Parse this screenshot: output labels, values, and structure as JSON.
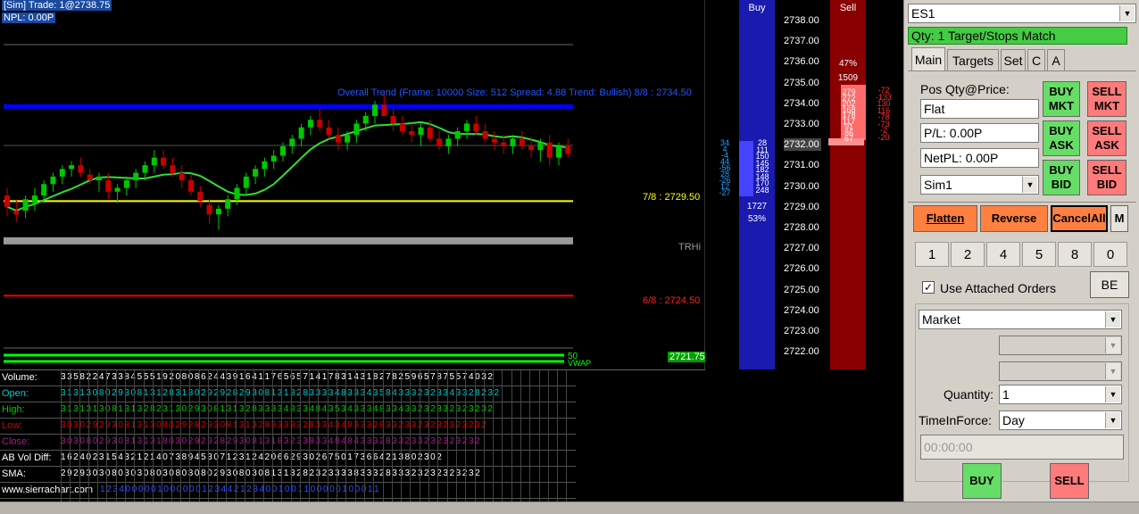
{
  "status": {
    "mode": "[Sim]",
    "trade": "Trade: 1@2738.75",
    "npl": "NPL: 0.00P"
  },
  "chart": {
    "overlay_label": "Overall Trend (Frame: 10000 Size: 512 Spread: 4.88 Trend: Bullish) 8/8 : 2734.50",
    "label_78": "7/8 : 2729.50",
    "label_trhi": "TRHi",
    "label_68": "6/8 : 2724.50",
    "label_50": "50",
    "label_vwap": "VWAP",
    "last_price": "2721.75",
    "colors": {
      "up": "#00c800",
      "down": "#c80000",
      "ma_up": "#33dd33",
      "ma_down": "#e040e0"
    }
  },
  "chart_data": {
    "type": "candlestick",
    "y_unit": "price",
    "ylim": [
      2721.5,
      2739.0
    ],
    "candles": [
      {
        "o": 2729.8,
        "h": 2730.2,
        "l": 2728.7,
        "c": 2729.2
      },
      {
        "o": 2729.0,
        "h": 2729.6,
        "l": 2728.4,
        "c": 2728.8
      },
      {
        "o": 2729.0,
        "h": 2729.8,
        "l": 2728.6,
        "c": 2729.6
      },
      {
        "o": 2729.4,
        "h": 2730.2,
        "l": 2729.0,
        "c": 2729.8
      },
      {
        "o": 2729.8,
        "h": 2730.6,
        "l": 2729.4,
        "c": 2730.4
      },
      {
        "o": 2730.4,
        "h": 2731.0,
        "l": 2730.0,
        "c": 2730.8
      },
      {
        "o": 2730.8,
        "h": 2731.4,
        "l": 2730.4,
        "c": 2731.2
      },
      {
        "o": 2731.2,
        "h": 2731.6,
        "l": 2730.8,
        "c": 2731.4
      },
      {
        "o": 2731.4,
        "h": 2731.8,
        "l": 2730.8,
        "c": 2731.0
      },
      {
        "o": 2730.9,
        "h": 2731.2,
        "l": 2730.4,
        "c": 2730.6
      },
      {
        "o": 2730.6,
        "h": 2731.0,
        "l": 2730.0,
        "c": 2730.8
      },
      {
        "o": 2730.6,
        "h": 2731.0,
        "l": 2729.6,
        "c": 2730.0
      },
      {
        "o": 2730.0,
        "h": 2730.4,
        "l": 2729.4,
        "c": 2730.2
      },
      {
        "o": 2730.2,
        "h": 2730.8,
        "l": 2729.8,
        "c": 2730.6
      },
      {
        "o": 2730.6,
        "h": 2731.2,
        "l": 2730.2,
        "c": 2731.0
      },
      {
        "o": 2731.0,
        "h": 2731.6,
        "l": 2730.6,
        "c": 2731.4
      },
      {
        "o": 2731.4,
        "h": 2732.2,
        "l": 2731.0,
        "c": 2731.8
      },
      {
        "o": 2731.8,
        "h": 2732.2,
        "l": 2731.2,
        "c": 2731.4
      },
      {
        "o": 2731.4,
        "h": 2731.8,
        "l": 2730.8,
        "c": 2731.0
      },
      {
        "o": 2731.0,
        "h": 2731.4,
        "l": 2730.2,
        "c": 2730.6
      },
      {
        "o": 2730.6,
        "h": 2730.9,
        "l": 2729.8,
        "c": 2730.0
      },
      {
        "o": 2730.0,
        "h": 2730.3,
        "l": 2729.2,
        "c": 2729.5
      },
      {
        "o": 2729.3,
        "h": 2729.6,
        "l": 2728.3,
        "c": 2728.8
      },
      {
        "o": 2728.8,
        "h": 2729.3,
        "l": 2728.0,
        "c": 2729.1
      },
      {
        "o": 2729.1,
        "h": 2729.8,
        "l": 2728.7,
        "c": 2729.6
      },
      {
        "o": 2729.6,
        "h": 2730.4,
        "l": 2729.3,
        "c": 2730.2
      },
      {
        "o": 2730.2,
        "h": 2731.0,
        "l": 2729.8,
        "c": 2730.8
      },
      {
        "o": 2730.8,
        "h": 2731.4,
        "l": 2730.4,
        "c": 2731.2
      },
      {
        "o": 2731.2,
        "h": 2731.8,
        "l": 2730.8,
        "c": 2731.6
      },
      {
        "o": 2731.6,
        "h": 2732.2,
        "l": 2731.2,
        "c": 2731.9
      },
      {
        "o": 2731.9,
        "h": 2732.6,
        "l": 2731.6,
        "c": 2732.4
      },
      {
        "o": 2732.4,
        "h": 2733.0,
        "l": 2732.0,
        "c": 2732.8
      },
      {
        "o": 2732.8,
        "h": 2733.6,
        "l": 2732.4,
        "c": 2733.4
      },
      {
        "o": 2733.4,
        "h": 2734.0,
        "l": 2733.0,
        "c": 2733.8
      },
      {
        "o": 2733.8,
        "h": 2734.4,
        "l": 2733.2,
        "c": 2733.4
      },
      {
        "o": 2733.4,
        "h": 2733.8,
        "l": 2732.8,
        "c": 2733.0
      },
      {
        "o": 2733.0,
        "h": 2733.4,
        "l": 2732.2,
        "c": 2732.6
      },
      {
        "o": 2732.6,
        "h": 2733.2,
        "l": 2732.2,
        "c": 2733.0
      },
      {
        "o": 2733.0,
        "h": 2733.8,
        "l": 2732.6,
        "c": 2733.6
      },
      {
        "o": 2733.6,
        "h": 2734.2,
        "l": 2733.2,
        "c": 2734.0
      },
      {
        "o": 2734.0,
        "h": 2734.8,
        "l": 2733.6,
        "c": 2734.6
      },
      {
        "o": 2734.6,
        "h": 2735.3,
        "l": 2734.2,
        "c": 2734.0
      },
      {
        "o": 2734.0,
        "h": 2734.4,
        "l": 2733.2,
        "c": 2733.6
      },
      {
        "o": 2733.6,
        "h": 2734.0,
        "l": 2733.0,
        "c": 2733.2
      },
      {
        "o": 2733.2,
        "h": 2733.6,
        "l": 2732.6,
        "c": 2733.0
      },
      {
        "o": 2733.0,
        "h": 2733.6,
        "l": 2732.4,
        "c": 2733.4
      },
      {
        "o": 2733.4,
        "h": 2733.8,
        "l": 2732.6,
        "c": 2732.8
      },
      {
        "o": 2732.8,
        "h": 2733.2,
        "l": 2732.2,
        "c": 2732.4
      },
      {
        "o": 2732.4,
        "h": 2733.0,
        "l": 2732.0,
        "c": 2732.8
      },
      {
        "o": 2732.8,
        "h": 2733.4,
        "l": 2732.4,
        "c": 2733.2
      },
      {
        "o": 2733.2,
        "h": 2733.8,
        "l": 2732.8,
        "c": 2733.6
      },
      {
        "o": 2733.6,
        "h": 2734.0,
        "l": 2733.0,
        "c": 2733.2
      },
      {
        "o": 2733.2,
        "h": 2733.6,
        "l": 2732.6,
        "c": 2732.8
      },
      {
        "o": 2732.8,
        "h": 2733.2,
        "l": 2732.2,
        "c": 2732.6
      },
      {
        "o": 2732.6,
        "h": 2733.0,
        "l": 2732.0,
        "c": 2732.4
      },
      {
        "o": 2732.4,
        "h": 2733.0,
        "l": 2732.0,
        "c": 2732.8
      },
      {
        "o": 2732.8,
        "h": 2733.2,
        "l": 2732.2,
        "c": 2732.4
      },
      {
        "o": 2732.4,
        "h": 2732.9,
        "l": 2731.8,
        "c": 2732.2
      },
      {
        "o": 2732.2,
        "h": 2732.8,
        "l": 2731.6,
        "c": 2732.6
      },
      {
        "o": 2732.6,
        "h": 2733.0,
        "l": 2731.4,
        "c": 2731.8
      },
      {
        "o": 2731.8,
        "h": 2732.6,
        "l": 2731.4,
        "c": 2732.4
      },
      {
        "o": 2732.4,
        "h": 2732.8,
        "l": 2731.8,
        "c": 2732.0
      }
    ],
    "levels": [
      {
        "name": "8/8",
        "value": 2734.5,
        "color": "#0000ff"
      },
      {
        "name": "7/8",
        "value": 2729.5,
        "color": "#ffff00"
      },
      {
        "name": "TRHi",
        "value": 2727.4,
        "color": "#999999"
      },
      {
        "name": "6/8",
        "value": 2724.5,
        "color": "#ff0000"
      }
    ]
  },
  "table": {
    "rows": [
      {
        "label": "Volume:",
        "color": "#ffffff",
        "cells": "3 3 5 8 2 2 4 7 3 3 8 4 5 5 5 1 9 2 0 8 0 8 6 2 4 4 3 9 1 6 4 1 1 7 6 5 6 5 7 1 4 1 7 8 3 1 4 3 1 8 2 7 8 2 5 9 6 5 7 8 7 5 5 7 4 0 3 2"
      },
      {
        "label": "Open:",
        "color": "#00c8c8",
        "cells": "3 1 3 1 3 0 8 0 2 9 3 0 8 1 3 1 2 8 3 1 3 0 2 9 2 9 2 8 2 9 3 0 8 1 3 1 3 2 8 3 3 3 3 4 8 3 3 3 4 3 5 8 4 3 3 3 2 3 2 3 3 4 3 3 2 8 2 3 2"
      },
      {
        "label": "High:",
        "color": "#00c800",
        "cells": "3 1 3 1 3 1 3 0 8 1 3 1 3 2 8 2 3 1 3 0 2 9 3 0 8 1 3 1 3 2 8 3 3 3 3 4 8 3 3 4 8 4 3 5 3 4 3 3 3 4 8 3 3 4 3 3 2 3 2 3 3 2 3 2 3 2 3 2"
      },
      {
        "label": "Low:",
        "color": "#d00000",
        "cells": "3 0 3 0 2 9 2 9 3 0 8 1 3 1 3 0 8 0 2 9 2 8 2 9 3 0 8 1 3 1 3 2 8 3 3 3 3 3 2 8 3 3 4 3 4 8 3 3 3 2 8 3 3 2 3 3 2 3 2 3 2 3 2 3 2 3 2"
      },
      {
        "label": "Close:",
        "color": "#a0208a",
        "cells": "3 0 3 0 8 0 2 9 3 0 8 1 3 1 3 1 8 0 3 0 2 9 2 9 2 8 2 9 3 0 8 1 3 1 8 3 2 3 3 8 3 3 4 8 4 8 4 3 3 3 2 8 3 3 2 3 3 2 3 2 3 2 3 2 3 2"
      },
      {
        "label": "AB Vol Diff:",
        "color": "#ffffff",
        "cells": "1 6 2 4 0 2 3 1 5 4 3 2 1 2 1 4 0 7 3 8 9 4 5 3 0 7 1 2 3 1 2 4 2 0 6 6 2 9 3 0 2 6 7 5 0 1 7 3 6 6 4 2 1 3 8 0 2 3 0 2"
      },
      {
        "label": "SMA:",
        "color": "#ffffff",
        "cells": "2 9 2 9 3 0 3 0 8 0 3 0 3 0 8 0 3 0 8 0 3 0 8 0 2 9 3 0 8 0 3 0 8 1 3 1 3 2 8 2 3 2 3 3 3 3 8 3 3 3 2 8 3 3 3 2 3 2 3 2 3 2 3 2 3 2"
      },
      {
        "label": "www.sierrachart.com",
        "color": "#ffffff",
        "cells": "1 2 3 4 0 0 0 0 0 1 0 0 0 0 0 0 1 2 3 4 4 2 1 2 3 4 0 0 1 0 0 1 1 0 0 0 0 0 1 0 0 0 1 1"
      }
    ]
  },
  "dom": {
    "buy_label": "Buy",
    "sell_label": "Sell",
    "prices": [
      "2738.00",
      "2737.00",
      "2736.00",
      "2735.00",
      "2734.00",
      "2733.00",
      "2732.00",
      "2731.00",
      "2730.00",
      "2729.00",
      "2728.00",
      "2727.00",
      "2726.00",
      "2725.00",
      "2724.00",
      "2723.00",
      "2722.00"
    ],
    "buy_total": "1727",
    "buy_pct": "53%",
    "sell_pct": "47%",
    "sell_total": "1509",
    "bid_sizes": [
      "28",
      "111",
      "150",
      "145",
      "182",
      "148",
      "170",
      "248"
    ],
    "ask_sizes": [
      "279",
      "272",
      "202",
      "168",
      "178",
      "117",
      "91",
      "86",
      "67"
    ],
    "left_nums": [
      "34",
      "4",
      "-4",
      "44",
      "-56",
      "28",
      "-26",
      "12",
      "-27"
    ],
    "right_nums": [
      "-72",
      "-133",
      "130",
      "116",
      "-78",
      "-73",
      "-2",
      "-20"
    ]
  },
  "panel": {
    "symbol": "ES1",
    "qty_banner": "Qty: 1 Target/Stops Match",
    "tabs": [
      "Main",
      "Targets",
      "Set",
      "C",
      "A"
    ],
    "pos_label": "Pos Qty@Price:",
    "pos_value": "Flat",
    "pl_value": "P/L: 0.00P",
    "netpl_value": "NetPL: 0.00P",
    "account": "Sim1",
    "buy_mkt": "BUY MKT",
    "sell_mkt": "SELL MKT",
    "buy_ask": "BUY ASK",
    "sell_ask": "SELL ASK",
    "buy_bid": "BUY BID",
    "sell_bid": "SELL BID",
    "flatten": "Flatten",
    "reverse": "Reverse",
    "cancel_all": "CancelAll",
    "m": "M",
    "qty_buttons": [
      "1",
      "2",
      "4",
      "5",
      "8",
      "0"
    ],
    "use_attached": "Use Attached Orders",
    "be": "BE",
    "order_type": "Market",
    "quantity_label": "Quantity:",
    "quantity": "1",
    "tif_label": "TimeInForce:",
    "tif": "Day",
    "time": "00:00:00",
    "buy": "BUY",
    "sell": "SELL"
  }
}
